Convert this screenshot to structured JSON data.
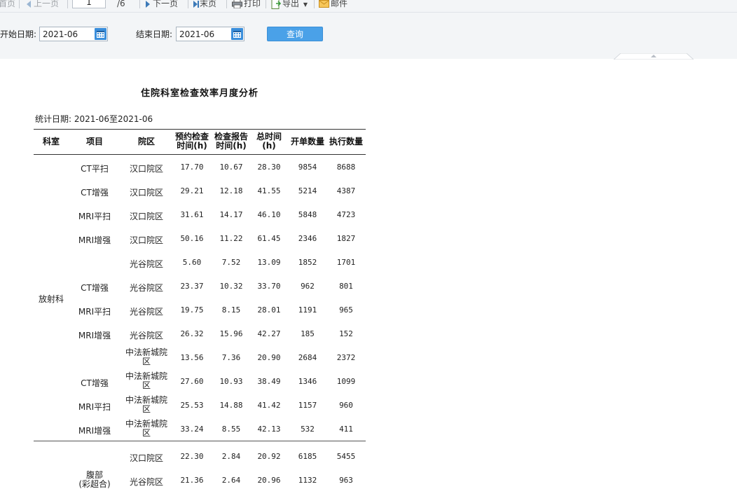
{
  "toolbar": {
    "first_page": "首页",
    "prev_page": "上一页",
    "page_current": "1",
    "page_total": "/6",
    "next_page": "下一页",
    "last_page": "末页",
    "print": "打印",
    "export": "导出",
    "mail": "邮件"
  },
  "filter": {
    "start_label": "开始日期:",
    "start_value": "2021-06",
    "end_label": "结束日期:",
    "end_value": "2021-06",
    "query_button": "查询"
  },
  "report": {
    "title": "住院科室检查效率月度分析",
    "stat_date": "统计日期: 2021-06至2021-06",
    "headers": {
      "dept": "科室",
      "item": "项目",
      "campus": "院区",
      "appt_1": "预约检查",
      "appt_2": "时间(h)",
      "report_1": "检查报告",
      "report_2": "时间(h)",
      "total_1": "总时间",
      "total_2": "(h)",
      "orders": "开单数量",
      "exec": "执行数量"
    },
    "dept_radiology": "放射科",
    "dept_abdomen_1": "腹部",
    "dept_abdomen_2": "(彩超合)",
    "rows": [
      {
        "item": "CT平扫",
        "campus1": "汉口院区",
        "campus2": "",
        "appt": "17.70",
        "report": "10.67",
        "total": "28.30",
        "orders": "9854",
        "exec": "8688"
      },
      {
        "item": "CT增强",
        "campus1": "汉口院区",
        "campus2": "",
        "appt": "29.21",
        "report": "12.18",
        "total": "41.55",
        "orders": "5214",
        "exec": "4387"
      },
      {
        "item": "MRI平扫",
        "campus1": "汉口院区",
        "campus2": "",
        "appt": "31.61",
        "report": "14.17",
        "total": "46.10",
        "orders": "5848",
        "exec": "4723"
      },
      {
        "item": "MRI增强",
        "campus1": "汉口院区",
        "campus2": "",
        "appt": "50.16",
        "report": "11.22",
        "total": "61.45",
        "orders": "2346",
        "exec": "1827"
      },
      {
        "item": "",
        "campus1": "光谷院区",
        "campus2": "",
        "appt": "5.60",
        "report": "7.52",
        "total": "13.09",
        "orders": "1852",
        "exec": "1701"
      },
      {
        "item": "CT增强",
        "campus1": "光谷院区",
        "campus2": "",
        "appt": "23.37",
        "report": "10.32",
        "total": "33.70",
        "orders": "962",
        "exec": "801"
      },
      {
        "item": "MRI平扫",
        "campus1": "光谷院区",
        "campus2": "",
        "appt": "19.75",
        "report": "8.15",
        "total": "28.01",
        "orders": "1191",
        "exec": "965"
      },
      {
        "item": "MRI增强",
        "campus1": "光谷院区",
        "campus2": "",
        "appt": "26.32",
        "report": "15.96",
        "total": "42.27",
        "orders": "185",
        "exec": "152"
      },
      {
        "item": "",
        "campus1": "中法新城院",
        "campus2": "区",
        "appt": "13.56",
        "report": "7.36",
        "total": "20.90",
        "orders": "2684",
        "exec": "2372"
      },
      {
        "item": "CT增强",
        "campus1": "中法新城院",
        "campus2": "区",
        "appt": "27.60",
        "report": "10.93",
        "total": "38.49",
        "orders": "1346",
        "exec": "1099"
      },
      {
        "item": "MRI平扫",
        "campus1": "中法新城院",
        "campus2": "区",
        "appt": "25.53",
        "report": "14.88",
        "total": "41.42",
        "orders": "1157",
        "exec": "960"
      },
      {
        "item": "MRI增强",
        "campus1": "中法新城院",
        "campus2": "区",
        "appt": "33.24",
        "report": "8.55",
        "total": "42.13",
        "orders": "532",
        "exec": "411"
      },
      {
        "item": "",
        "campus1": "汉口院区",
        "campus2": "",
        "appt": "22.30",
        "report": "2.84",
        "total": "20.92",
        "orders": "6185",
        "exec": "5455"
      },
      {
        "item": "",
        "campus1": "光谷院区",
        "campus2": "",
        "appt": "21.36",
        "report": "2.64",
        "total": "20.96",
        "orders": "1132",
        "exec": "963"
      }
    ]
  },
  "colors": {
    "toolbar_bg": "#f3f5f7",
    "query_button": "#4aa1e8",
    "calendar_icon": "#3a8edb"
  }
}
